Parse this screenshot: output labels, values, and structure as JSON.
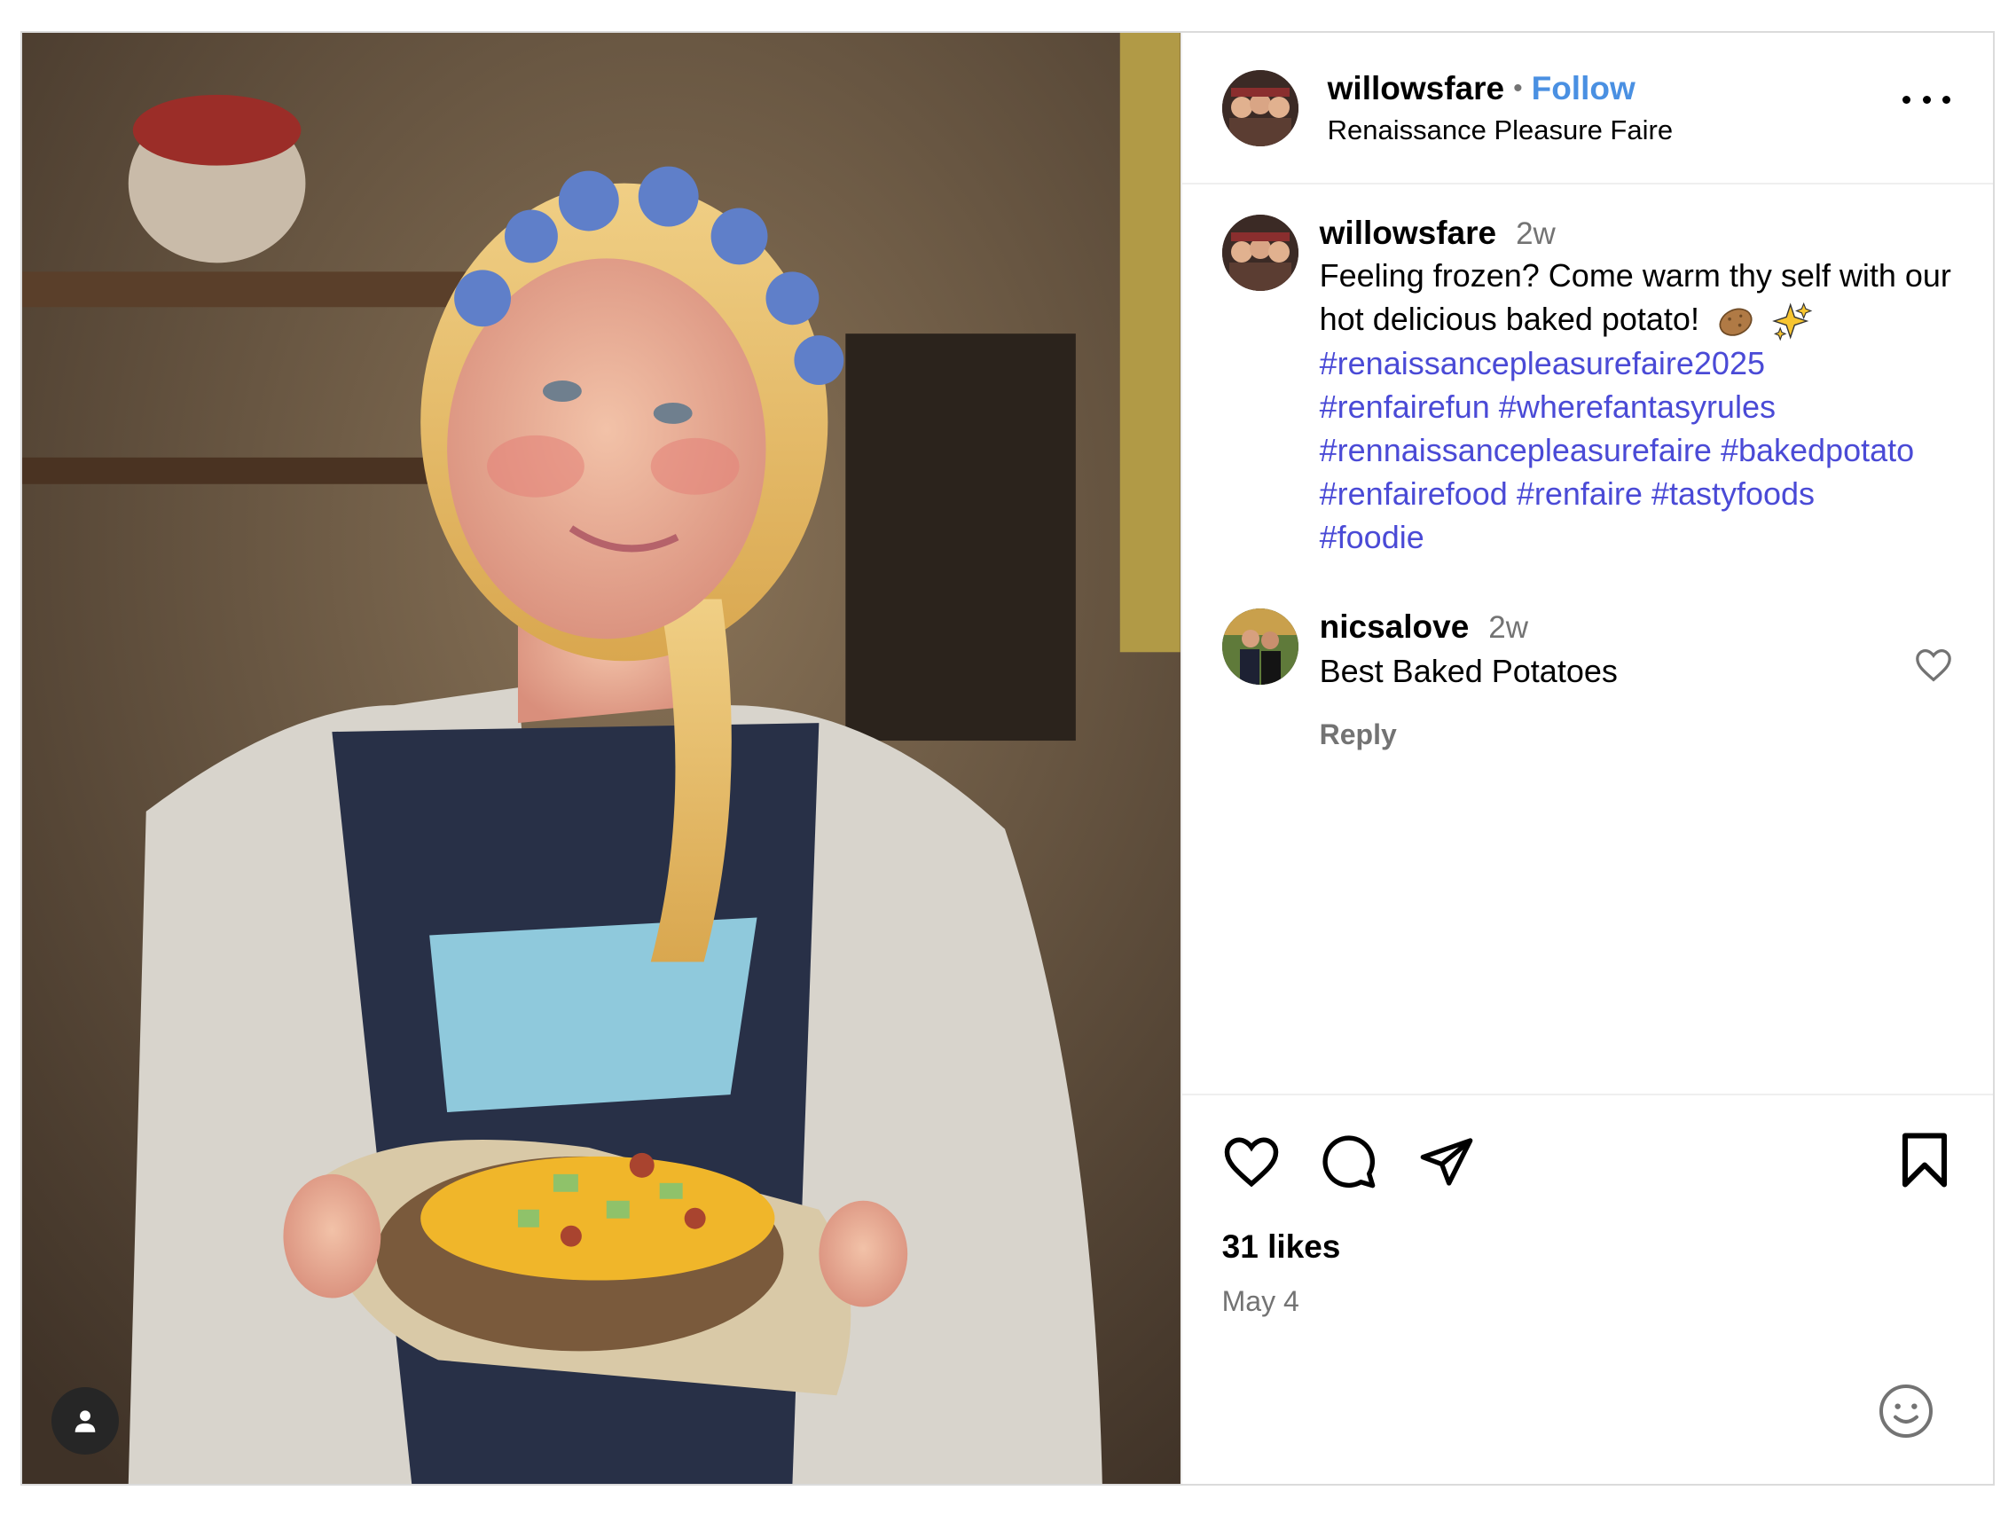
{
  "post": {
    "photo": {
      "description_icon": "person-tag-icon"
    },
    "header": {
      "username": "willowsfare",
      "separator": "•",
      "follow_label": "Follow",
      "location": "Renaissance Pleasure Faire",
      "more_icon": "more-horizontal-icon"
    },
    "caption": {
      "username": "willowsfare",
      "time": "2w",
      "text": "Feeling frozen? Come warm thy self with our hot delicious baked potato!",
      "emojis": [
        "potato-emoji",
        "sparkles-emoji"
      ],
      "hashtags": [
        "#renaissancepleasurefaire2025",
        "#renfairefun",
        "#wherefantasyrules",
        "#rennaissancepleasurefaire",
        "#bakedpotato",
        "#renfairefood",
        "#renfaire",
        "#tastyfoods",
        "#foodie"
      ]
    },
    "comments": [
      {
        "username": "nicsalove",
        "time": "2w",
        "text": "Best Baked Potatoes",
        "reply_label": "Reply"
      }
    ],
    "actions": {
      "like_icon": "heart-icon",
      "comment_icon": "comment-icon",
      "share_icon": "share-icon",
      "save_icon": "bookmark-icon",
      "likes": "31 likes",
      "date": "May 4",
      "emoji_icon": "smiley-icon"
    }
  }
}
